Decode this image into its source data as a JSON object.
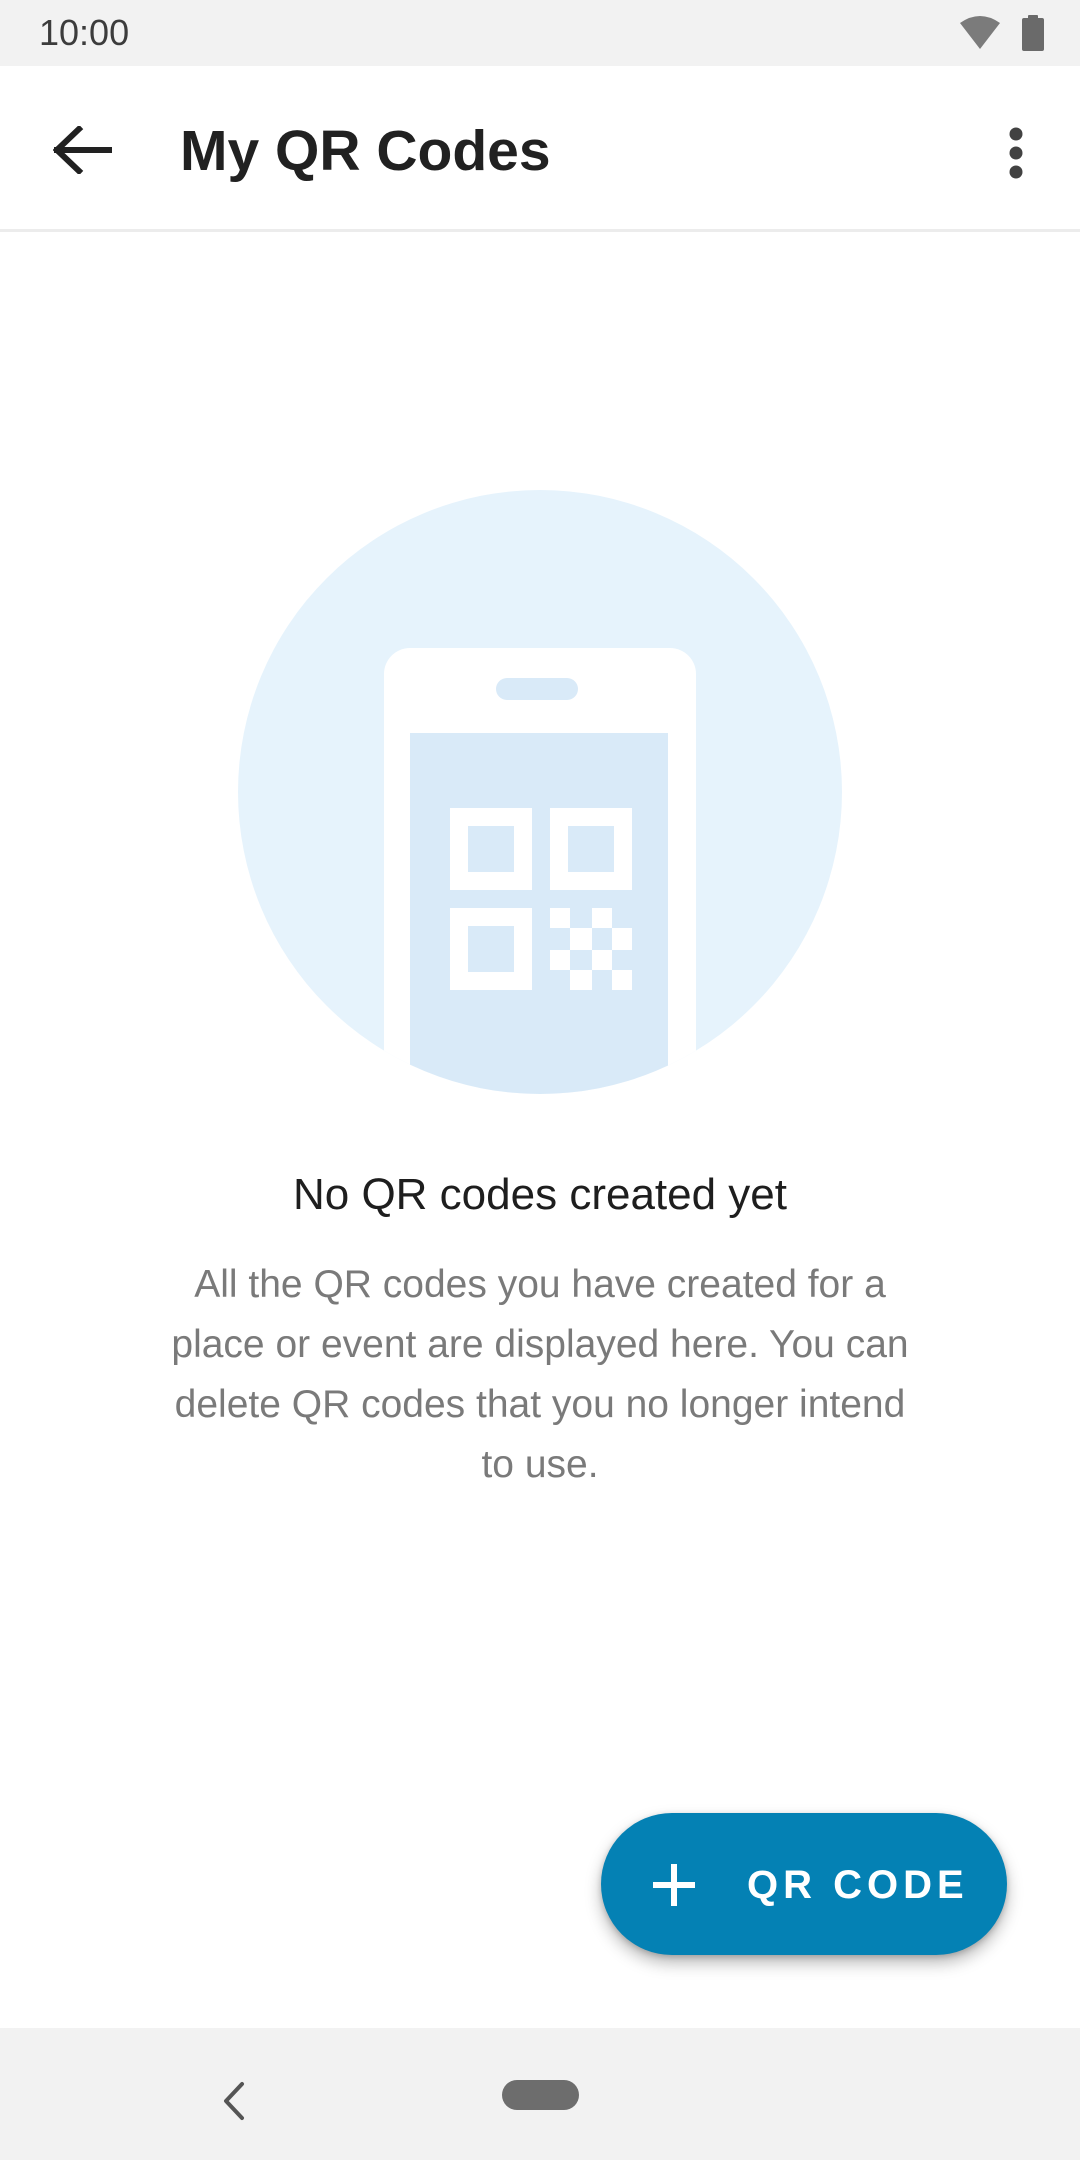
{
  "status_bar": {
    "time": "10:00",
    "icons": [
      "wifi-icon",
      "battery-icon"
    ]
  },
  "app_bar": {
    "back_icon": "arrow-left-icon",
    "title": "My QR Codes",
    "menu_icon": "more-vert-icon"
  },
  "empty_state": {
    "illustration": "phone-qr-code-illustration",
    "title": "No QR codes created yet",
    "description": "All the QR codes you have created for a place or event are displayed here. You can delete QR codes that you no longer intend to use."
  },
  "fab": {
    "icon": "plus-icon",
    "label": "QR CODE"
  },
  "nav_bar": {
    "icons": [
      "nav-back-icon",
      "home-pill-icon"
    ]
  },
  "colors": {
    "accent": "#0481b4",
    "illustration_circle": "#e6f3fc",
    "illustration_screen": "#d9eaf8",
    "status_bar": "#f2f2f2"
  }
}
